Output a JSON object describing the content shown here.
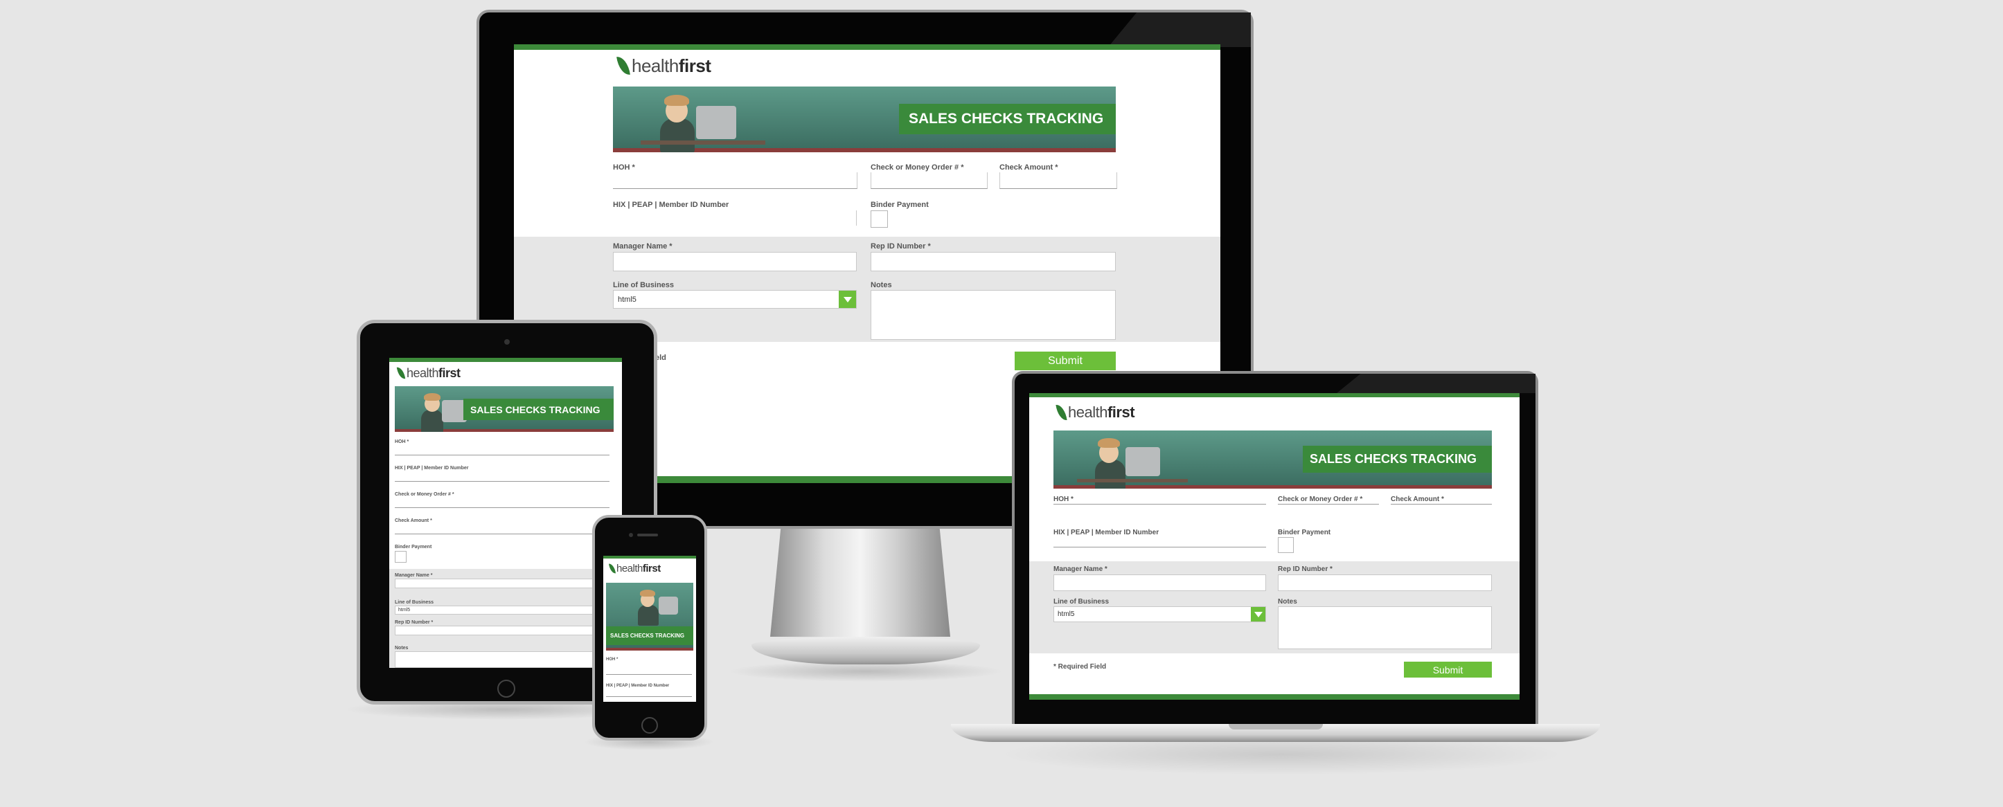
{
  "brand": {
    "logo_light": "health",
    "logo_bold": "first",
    "colors": {
      "green": "#3d8a3a",
      "button": "#6cbf3a"
    }
  },
  "banner": {
    "title": "SALES CHECKS TRACKING"
  },
  "form": {
    "hoh_label": "HOH *",
    "check_label": "Check or Money Order # *",
    "amount_label": "Check Amount *",
    "hix_label": "HIX | PEAP | Member ID Number",
    "binder_label": "Binder Payment",
    "manager_label": "Manager Name *",
    "rep_label": "Rep ID Number *",
    "lob_label": "Line of Business",
    "lob_value": "html5",
    "notes_label": "Notes",
    "submit_label": "Submit",
    "required_label": "* Required Field",
    "required_fragment": "eld"
  }
}
